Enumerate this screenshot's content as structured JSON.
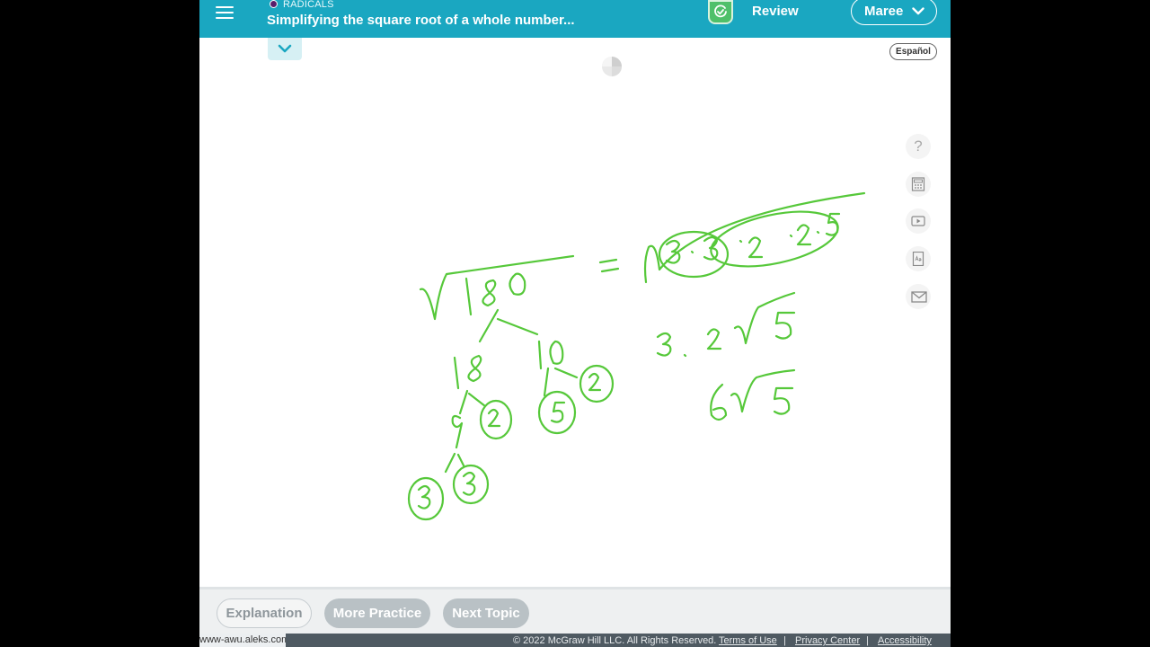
{
  "header": {
    "topic_label": "RADICALS",
    "topic_title": "Simplifying the square root of a whole number...",
    "review_label": "Review",
    "user_name": "Maree"
  },
  "language_button": "Español",
  "tools": {
    "help_glyph": "?",
    "icons": [
      "help-icon",
      "calculator-icon",
      "video-icon",
      "dictionary-icon",
      "mail-icon"
    ]
  },
  "drawing": {
    "radicand": "180",
    "factors_level1": [
      "18",
      "10"
    ],
    "factors_level2": [
      "9",
      "2",
      "5",
      "2"
    ],
    "factors_level3": [
      "3",
      "3"
    ],
    "expanded_form": "= √3·3·2·2·5",
    "step1": "3·2√5",
    "answer": "6√5",
    "ink_color": "#56c83a"
  },
  "bottom_bar": {
    "explanation": "Explanation",
    "more_practice": "More Practice",
    "next_topic": "Next Topic"
  },
  "footer": {
    "url": "www-awu.aleks.com",
    "copyright": "© 2022 McGraw Hill LLC. All Rights Reserved.",
    "terms": "Terms of Use",
    "privacy": "Privacy Center",
    "accessibility": "Accessibility",
    "separator": "|"
  },
  "colors": {
    "header_bg": "#1aa7c1",
    "review_green": "#4fc06a",
    "topic_dot": "#5a1f6b",
    "footer_bg": "#4f5a62"
  }
}
